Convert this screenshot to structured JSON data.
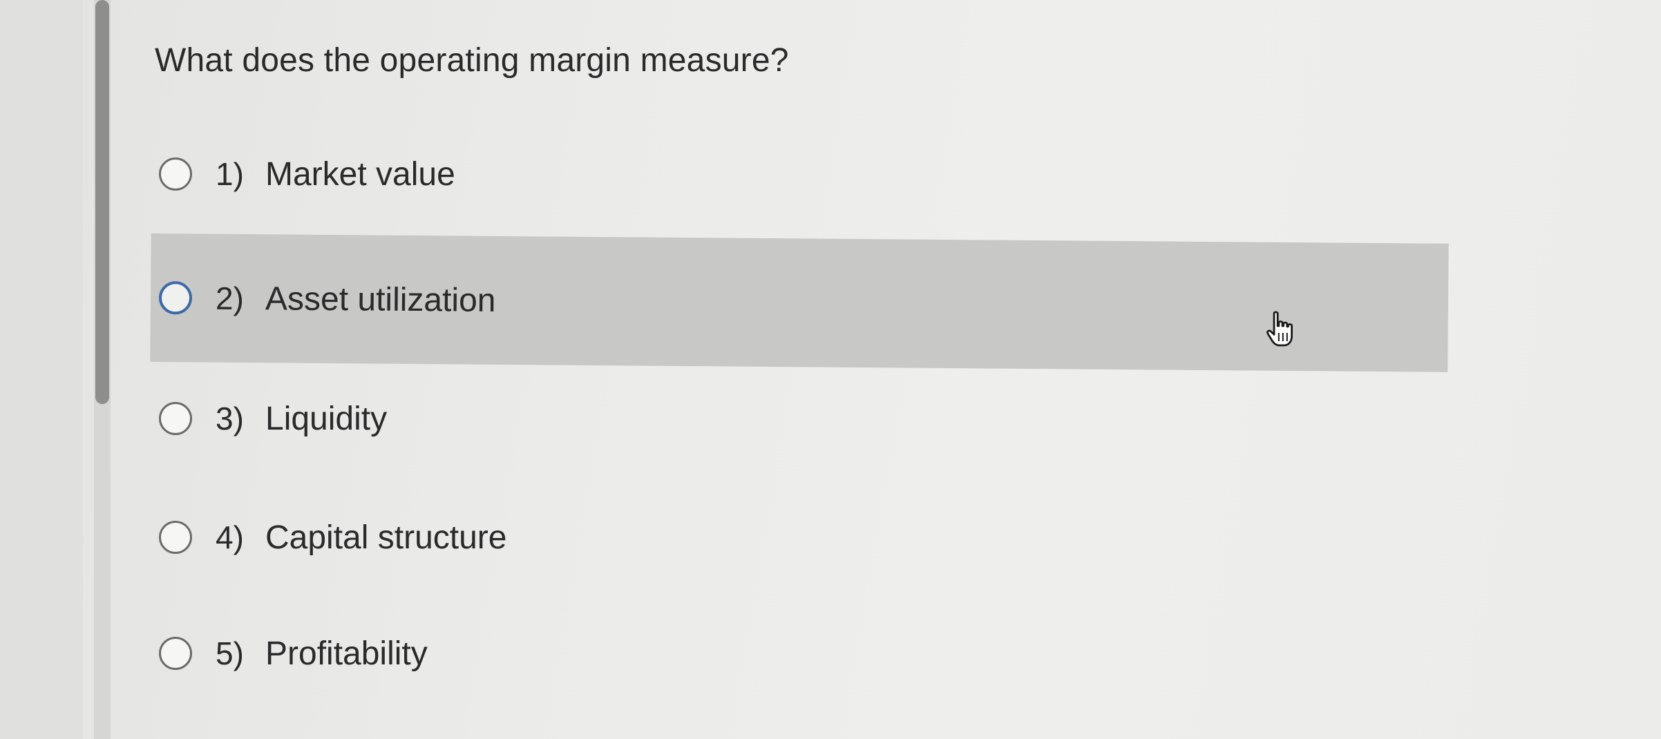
{
  "quiz": {
    "question": "What does the operating margin measure?",
    "options": [
      {
        "number": "1)",
        "label": "Market value",
        "selected": false
      },
      {
        "number": "2)",
        "label": "Asset utilization",
        "selected": false
      },
      {
        "number": "3)",
        "label": "Liquidity",
        "selected": false
      },
      {
        "number": "4)",
        "label": "Capital structure",
        "selected": false
      },
      {
        "number": "5)",
        "label": "Profitability",
        "selected": false
      }
    ]
  },
  "colors": {
    "background": "#ebebe9",
    "hover_row": "#c8c8c6",
    "focus_ring": "#3d6aa6",
    "text": "#2a2a2a"
  },
  "icons": {
    "cursor": "hand-pointer-icon"
  }
}
